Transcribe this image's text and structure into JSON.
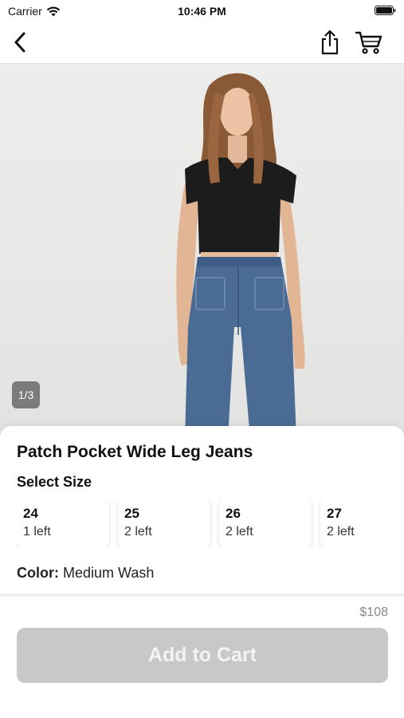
{
  "status_bar": {
    "carrier": "Carrier",
    "time": "10:46 PM"
  },
  "nav": {
    "back_icon": "chevron-left-icon",
    "share_icon": "share-icon",
    "cart_icon": "cart-icon"
  },
  "gallery": {
    "counter": "1/3"
  },
  "product": {
    "title": "Patch Pocket Wide Leg Jeans",
    "size_heading": "Select Size",
    "sizes": [
      {
        "size": "24",
        "stock": "1 left"
      },
      {
        "size": "25",
        "stock": "2 left"
      },
      {
        "size": "26",
        "stock": "2 left"
      },
      {
        "size": "27",
        "stock": "2 left"
      }
    ],
    "color_label": "Color:",
    "color_value": "Medium Wash"
  },
  "purchase": {
    "price": "$108",
    "add_to_cart_label": "Add to Cart"
  },
  "colors": {
    "button_disabled": "#c8c8c8",
    "counter_badge": "#7b7b7b",
    "jeans": "#4a6b94",
    "top": "#1c1c1c"
  }
}
